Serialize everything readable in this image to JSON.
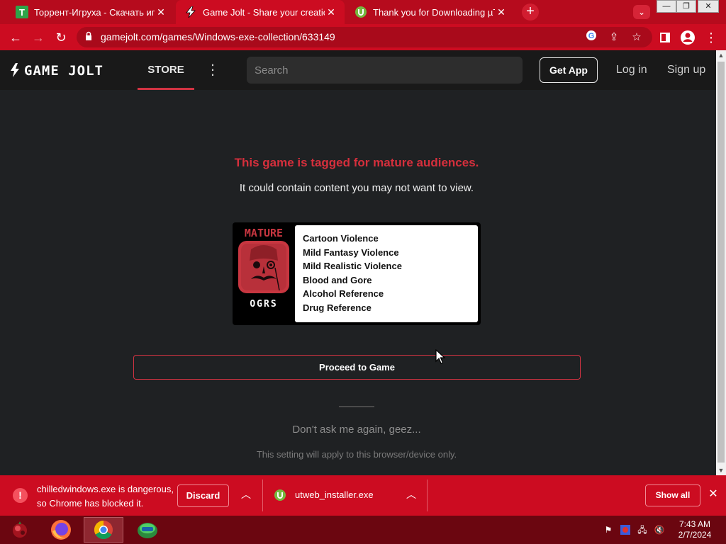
{
  "browser": {
    "tabs": [
      {
        "title": "Торрент-Игруха - Скачать игры",
        "favicon": "torrent-igruha-favicon",
        "active": false
      },
      {
        "title": "Game Jolt - Share your creations",
        "favicon": "gamejolt-favicon",
        "active": true
      },
      {
        "title": "Thank you for Downloading µTor",
        "favicon": "utorrent-favicon",
        "active": false
      }
    ],
    "url": "gamejolt.com/games/Windows-exe-collection/633149",
    "accent_color": "#cc0c21"
  },
  "site": {
    "logo_text": "GAME JOLT",
    "nav": {
      "store": "STORE",
      "search_placeholder": "Search",
      "get_app": "Get App",
      "log_in": "Log in",
      "sign_up": "Sign up"
    }
  },
  "maturity": {
    "heading": "This game is tagged for mature audiences.",
    "subheading": "It could contain content you may not want to view.",
    "badge_top": "MATURE",
    "badge_bottom": "OGRS",
    "descriptors": [
      "Cartoon Violence",
      "Mild Fantasy Violence",
      "Mild Realistic Violence",
      "Blood and Gore",
      "Alcohol Reference",
      "Drug Reference"
    ],
    "proceed_label": "Proceed to Game",
    "dont_ask_label": "Don't ask me again, geez...",
    "setting_note": "This setting will apply to this browser/device only."
  },
  "downloads": {
    "blocked": {
      "line1": "chilledwindows.exe is dangerous,",
      "line2": "so Chrome has blocked it.",
      "discard_label": "Discard"
    },
    "file": {
      "name": "utweb_installer.exe"
    },
    "show_all_label": "Show all"
  },
  "taskbar": {
    "time": "7:43 AM",
    "date": "2/7/2024"
  }
}
